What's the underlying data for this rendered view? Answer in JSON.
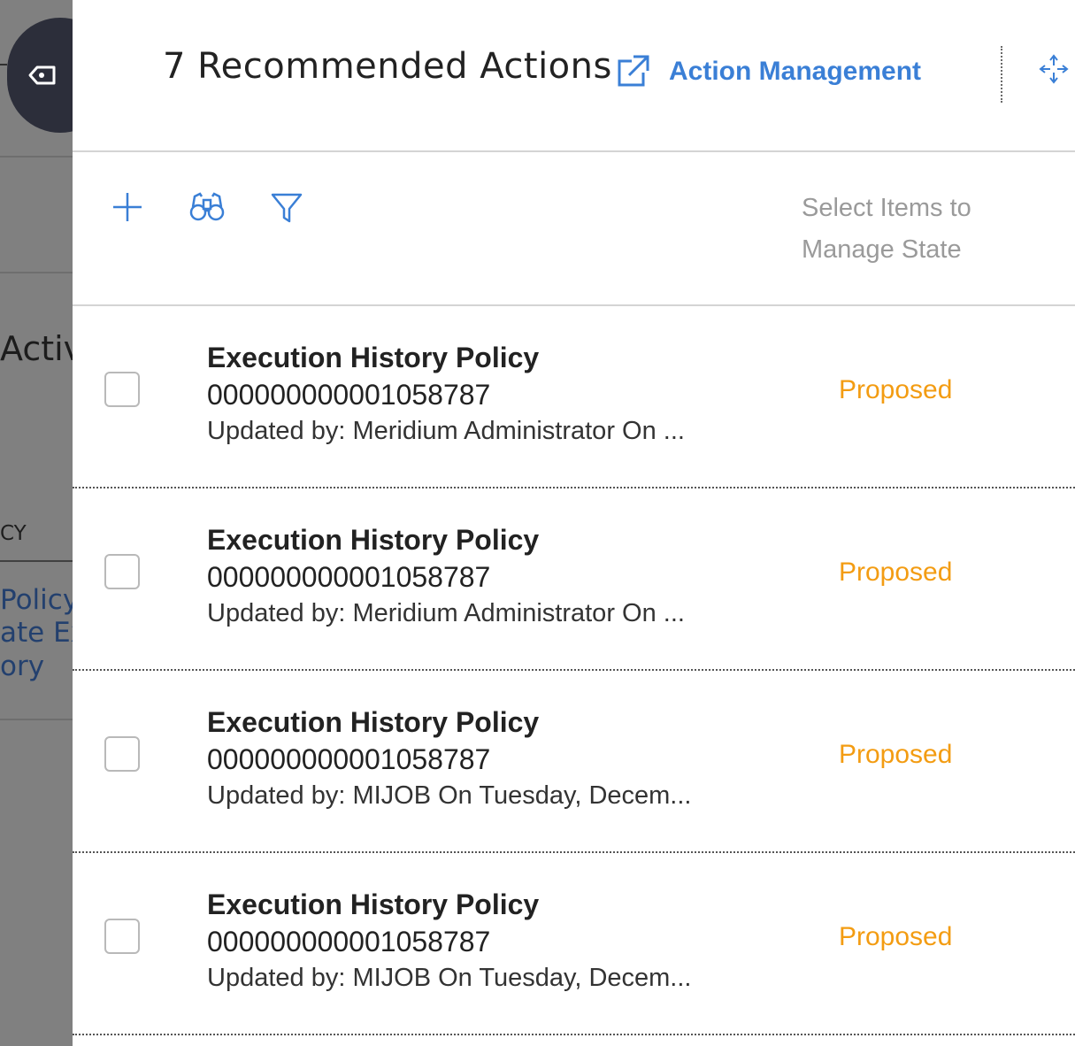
{
  "background": {
    "title_fragment": "Activ",
    "column_fragment": "CY",
    "link_lines": [
      "Policy",
      "ate Ex",
      "ory"
    ]
  },
  "panel": {
    "title": "7 Recommended Actions",
    "action_link_label": "Action Management",
    "manage_state_hint": "Select Items to Manage State"
  },
  "colors": {
    "accent": "#3a7fd6",
    "status_proposed": "#f39c12",
    "overlay": "#808080"
  },
  "icons": {
    "add": "plus-icon",
    "search": "binoculars-icon",
    "filter": "funnel-icon",
    "external": "external-link-icon",
    "move": "move-arrows-icon"
  },
  "actions": [
    {
      "title": "Execution History Policy",
      "id": "000000000001058787",
      "updated": "Updated by: Meridium Administrator On ...",
      "status": "Proposed"
    },
    {
      "title": "Execution History Policy",
      "id": "000000000001058787",
      "updated": "Updated by: Meridium Administrator On ...",
      "status": "Proposed"
    },
    {
      "title": "Execution History Policy",
      "id": "000000000001058787",
      "updated": "Updated by:  MIJOB On  Tuesday, Decem...",
      "status": "Proposed"
    },
    {
      "title": "Execution History Policy",
      "id": "000000000001058787",
      "updated": "Updated by:  MIJOB On  Tuesday, Decem...",
      "status": "Proposed"
    }
  ]
}
